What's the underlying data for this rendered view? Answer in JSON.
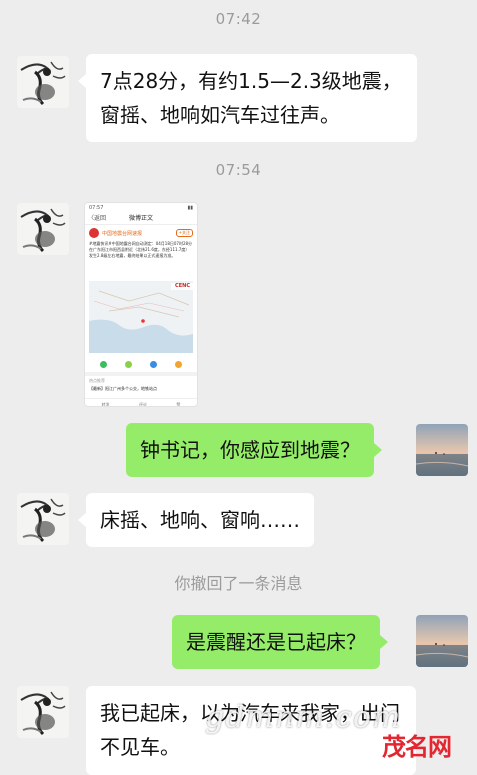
{
  "messages": {
    "time_1": "07:42",
    "msg_1": "7点28分，有约1.5—2.3级地震，窗摇、地响如汽车过往声。",
    "time_2": "07:54",
    "msg_3": "钟书记，你感应到地震？",
    "msg_4": "床摇、地响、窗响……",
    "recall_notice": "你撤回了一条消息",
    "msg_5": "是震醒还是已起床？",
    "msg_6": "我已起床，以为汽车来我家，出门不见车。"
  },
  "shared_image": {
    "status_time": "07:57",
    "nav_back": "〈返回",
    "nav_title": "微博正文",
    "account_name": "中国地震台网速报",
    "follow": "+关注",
    "post_text": "#地震快讯#中国地震台网自动测定：04月18日07时28分在广东阳江市阳西县附近（北纬21.6度，东经111.7度）发生2.8级左右地震，最终结果以正式速报为准。",
    "map_logo": "CENC",
    "hot_label": "热点推荐",
    "hot_news": "【最新】阳江广州多个公交，地铁站点",
    "foot_share": "转发",
    "foot_comment": "评论",
    "foot_like": "赞"
  },
  "watermark": {
    "text": "gdmnm.com",
    "logo": "茂名网"
  },
  "colors": {
    "background": "#ededed",
    "bubble_left": "#ffffff",
    "bubble_right": "#95ec69",
    "timestamp": "#9b9b9b",
    "watermark_logo": "#e3262f"
  }
}
